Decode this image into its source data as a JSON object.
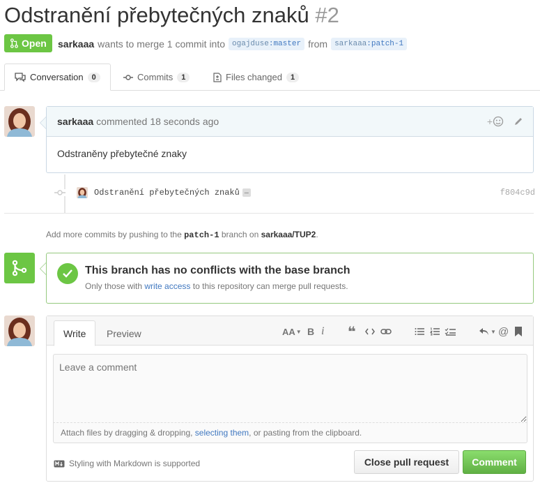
{
  "pr": {
    "title": "Odstranění přebytečných znaků",
    "number": "#2",
    "state": "Open",
    "author": "sarkaaa",
    "meta_text": "wants to merge 1 commit into",
    "base_owner": "ogajduse",
    "base_branch": "master",
    "from_text": "from",
    "head_owner": "sarkaaa",
    "head_branch": "patch-1"
  },
  "tabs": [
    {
      "label": "Conversation",
      "count": "0"
    },
    {
      "label": "Commits",
      "count": "1"
    },
    {
      "label": "Files changed",
      "count": "1"
    }
  ],
  "comment": {
    "author": "sarkaaa",
    "action": "commented",
    "time": "18 seconds ago",
    "body": "Odstraněny přebytečné znaky",
    "reaction_plus": "+"
  },
  "commit": {
    "message": "Odstranění přebytečných znaků",
    "ellipsis": "…",
    "sha": "f804c9d"
  },
  "hint": {
    "prefix": "Add more commits by pushing to the",
    "branch": "patch-1",
    "middle": "branch on",
    "repo": "sarkaaa/TUP2",
    "suffix": "."
  },
  "merge": {
    "title": "This branch has no conflicts with the base branch",
    "desc_prefix": "Only those with",
    "desc_link": "write access",
    "desc_suffix": "to this repository can merge pull requests."
  },
  "new_comment": {
    "tab_write": "Write",
    "tab_preview": "Preview",
    "placeholder": "Leave a comment",
    "attach_prefix": "Attach files by dragging & dropping,",
    "attach_link": "selecting them",
    "attach_suffix": ", or pasting from the clipboard.",
    "markdown_note": "Styling with Markdown is supported",
    "close_button": "Close pull request",
    "comment_button": "Comment",
    "toolbar": {
      "header": "AA",
      "bold": "B",
      "italic": "i",
      "quote": "❝",
      "at": "@"
    }
  },
  "colors": {
    "open_green": "#6cc644",
    "link": "#4078c0",
    "comment_header": "#f2f8fa"
  }
}
